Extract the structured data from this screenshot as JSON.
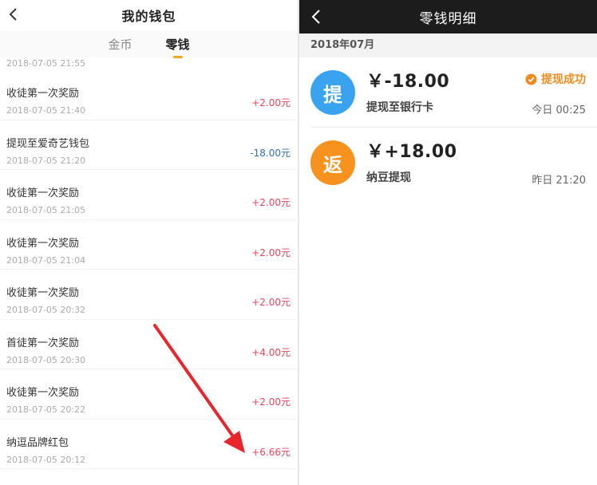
{
  "left": {
    "title": "我的钱包",
    "tabs": [
      {
        "label": "金币",
        "active": false
      },
      {
        "label": "零钱",
        "active": true
      }
    ],
    "top_time": "2018-07-05 21:55",
    "records": [
      {
        "name": "收徒第一次奖励",
        "time": "2018-07-05 21:40",
        "amount": "+2.00元",
        "type": "pos"
      },
      {
        "name": "提现至爱奇艺钱包",
        "time": "2018-07-05 21:20",
        "amount": "-18.00元",
        "type": "neg"
      },
      {
        "name": "收徒第一次奖励",
        "time": "2018-07-05 21:05",
        "amount": "+2.00元",
        "type": "pos"
      },
      {
        "name": "收徒第一次奖励",
        "time": "2018-07-05 21:04",
        "amount": "+2.00元",
        "type": "pos"
      },
      {
        "name": "收徒第一次奖励",
        "time": "2018-07-05 20:32",
        "amount": "+2.00元",
        "type": "pos"
      },
      {
        "name": "首徒第一次奖励",
        "time": "2018-07-05 20:30",
        "amount": "+4.00元",
        "type": "pos"
      },
      {
        "name": "收徒第一次奖励",
        "time": "2018-07-05 20:22",
        "amount": "+2.00元",
        "type": "pos"
      },
      {
        "name": "纳逗品牌红包",
        "time": "2018-07-05 20:12",
        "amount": "+6.66元",
        "type": "pos"
      }
    ],
    "colors": {
      "positive": "#e8455a",
      "negative": "#2f6fc0",
      "tab_indicator": "#f5a623",
      "annotation_arrow": "#e8262c"
    }
  },
  "right": {
    "title": "零钱明细",
    "month": "2018年07月",
    "transactions": [
      {
        "badge": "提",
        "badge_color": "blue",
        "amount": "￥-18.00",
        "desc": "提现至银行卡",
        "status": "提现成功",
        "date": "今日 00:25"
      },
      {
        "badge": "返",
        "badge_color": "orange",
        "amount": "￥+18.00",
        "desc": "纳豆提现",
        "status": "",
        "date": "昨日 21:20"
      }
    ],
    "colors": {
      "header_bg": "#1c1c1c",
      "badge_blue": "#3aa3f0",
      "badge_orange": "#f7921e",
      "status": "#f08c1f"
    }
  },
  "icons": {
    "back": "chevron-left-icon",
    "check": "check-circle-icon",
    "annotation": "red-arrow-icon"
  }
}
